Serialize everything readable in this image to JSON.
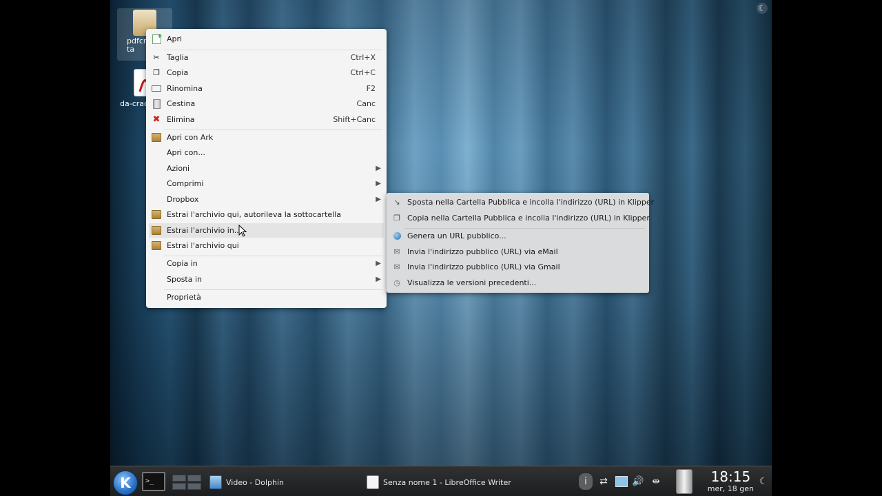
{
  "desktop": {
    "icons": [
      {
        "label": "pdfcra\nta",
        "icon": "package-icon"
      },
      {
        "label": "da-crac",
        "icon": "pdf-icon"
      }
    ]
  },
  "context_menu": {
    "items": [
      {
        "label": "Apri",
        "shortcut": "",
        "icon": "open-icon"
      },
      {
        "label": "Taglia",
        "shortcut": "Ctrl+X",
        "icon": "scissors-icon"
      },
      {
        "label": "Copia",
        "shortcut": "Ctrl+C",
        "icon": "copy-icon"
      },
      {
        "label": "Rinomina",
        "shortcut": "F2",
        "icon": "rename-icon"
      },
      {
        "label": "Cestina",
        "shortcut": "Canc",
        "icon": "trash-icon"
      },
      {
        "label": "Elimina",
        "shortcut": "Shift+Canc",
        "icon": "delete-icon"
      },
      {
        "label": "Apri con Ark",
        "shortcut": "",
        "icon": "ark-icon"
      },
      {
        "label": "Apri con...",
        "shortcut": "",
        "icon": ""
      },
      {
        "label": "Azioni",
        "shortcut": "",
        "icon": "",
        "submenu": true
      },
      {
        "label": "Comprimi",
        "shortcut": "",
        "icon": "",
        "submenu": true
      },
      {
        "label": "Dropbox",
        "shortcut": "",
        "icon": "",
        "submenu": true
      },
      {
        "label": "Estrai l'archivio qui, autorileva la sottocartella",
        "shortcut": "",
        "icon": "ark-icon"
      },
      {
        "label": "Estrai l'archivio in...",
        "shortcut": "",
        "icon": "ark-icon"
      },
      {
        "label": "Estrai l'archivio qui",
        "shortcut": "",
        "icon": "ark-icon"
      },
      {
        "label": "Copia in",
        "shortcut": "",
        "icon": "",
        "submenu": true
      },
      {
        "label": "Sposta in",
        "shortcut": "",
        "icon": "",
        "submenu": true
      },
      {
        "label": "Proprietà",
        "shortcut": "",
        "icon": ""
      }
    ]
  },
  "dropbox_submenu": {
    "items": [
      {
        "label": "Sposta nella Cartella Pubblica e incolla l'indirizzo (URL) in Klipper",
        "icon": "move-icon"
      },
      {
        "label": "Copia nella Cartella Pubblica e incolla l'indirizzo (URL) in Klipper",
        "icon": "copy-icon"
      },
      {
        "label": "Genera un URL pubblico...",
        "icon": "link-icon"
      },
      {
        "label": "Invia l'indirizzo pubblico (URL) via eMail",
        "icon": "mail-icon"
      },
      {
        "label": "Invia l'indirizzo pubblico (URL) via Gmail",
        "icon": "mail-icon"
      },
      {
        "label": "Visualizza le versioni precedenti...",
        "icon": "clock-icon"
      }
    ]
  },
  "taskbar": {
    "terminal_prompt": ">_",
    "tasks": [
      {
        "label": "Video - Dolphin",
        "icon": "dolphin-icon"
      },
      {
        "label": "Senza nome 1 - LibreOffice Writer",
        "icon": "writer-icon"
      }
    ],
    "clock": {
      "time": "18:15",
      "date": "mer, 18 gen"
    }
  },
  "colors": {
    "menu_bg": "#f4f4f4",
    "menu_highlight": "#e4e4e4",
    "taskbar_bg": "#252628",
    "desktop_accent": "#5a8fb3"
  }
}
